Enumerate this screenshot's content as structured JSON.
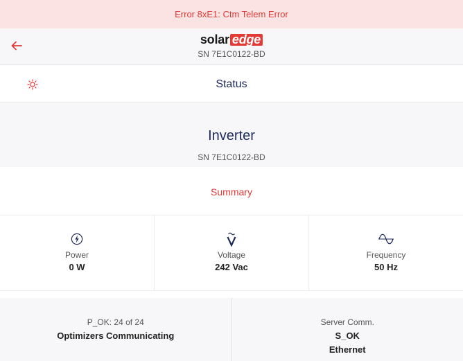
{
  "error_banner": {
    "text": "Error 8xE1: Ctm Telem Error"
  },
  "header": {
    "logo_part1": "solar",
    "logo_part2": "edge",
    "serial": "SN 7E1C0122-BD",
    "back_icon": "arrow-left-icon"
  },
  "status_row": {
    "title": "Status",
    "icon": "sun-icon"
  },
  "device": {
    "title": "Inverter",
    "serial": "SN 7E1C0122-BD"
  },
  "summary": {
    "title": "Summary"
  },
  "metrics": [
    {
      "icon": "lightning-icon",
      "label": "Power",
      "value": "0 W"
    },
    {
      "icon": "voltage-icon",
      "label": "Voltage",
      "value": "242 Vac"
    },
    {
      "icon": "sine-wave-icon",
      "label": "Frequency",
      "value": "50 Hz"
    }
  ],
  "optimizers": {
    "count_text": "P_OK: 24 of 24",
    "label": "Optimizers Communicating"
  },
  "server_comm": {
    "label": "Server Comm.",
    "status": "S_OK",
    "connection": "Ethernet"
  },
  "colors": {
    "accent": "#e53935",
    "navy": "#1e2a5a",
    "panel_bg": "#f7f7f9"
  }
}
